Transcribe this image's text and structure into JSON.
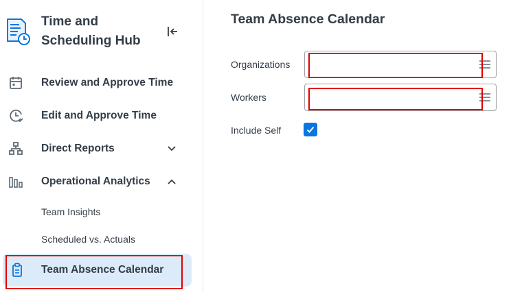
{
  "sidebar": {
    "hub_title": "Time and Scheduling Hub",
    "items": [
      {
        "label": "Review and Approve Time",
        "icon": "calendar-check-icon"
      },
      {
        "label": "Edit and Approve Time",
        "icon": "clock-check-icon"
      },
      {
        "label": "Direct Reports",
        "icon": "org-chart-icon",
        "chevron": "down"
      },
      {
        "label": "Operational Analytics",
        "icon": "bar-chart-icon",
        "chevron": "up"
      }
    ],
    "sub_items": [
      {
        "label": "Team Insights"
      },
      {
        "label": "Scheduled vs. Actuals"
      }
    ],
    "active_item": {
      "label": "Team Absence Calendar",
      "icon": "clipboard-icon"
    }
  },
  "main": {
    "title": "Team Absence Calendar",
    "fields": {
      "organizations_label": "Organizations",
      "organizations_value": "",
      "workers_label": "Workers",
      "workers_value": "",
      "include_self_label": "Include Self",
      "include_self_checked": true
    }
  },
  "colors": {
    "accent": "#0875e1",
    "active_bg": "#dcebfa",
    "highlight": "#e00000",
    "icon": "#5e6a75"
  }
}
